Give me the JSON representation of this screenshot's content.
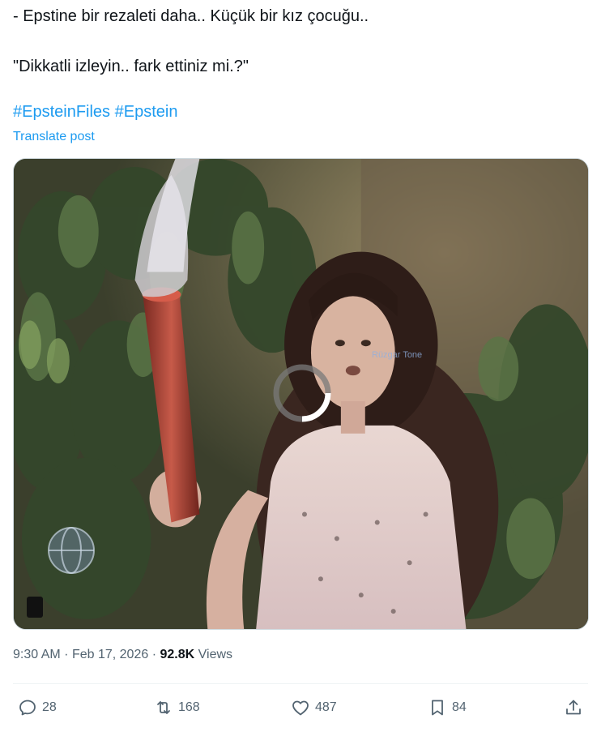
{
  "post": {
    "line1": "- Epstine bir rezaleti daha.. Küçük bir kız çocuğu..",
    "line2": "\"Dikkatli izleyin.. fark ettiniz mi.?\"",
    "hashtags": [
      "#EpsteinFiles",
      "#Epstein"
    ],
    "translate_label": "Translate post"
  },
  "media": {
    "watermark": "Rüzgar Tone"
  },
  "meta": {
    "time": "9:30 AM",
    "date": "Feb 17, 2026",
    "separator": "·",
    "views_count": "92.8K",
    "views_label": "Views"
  },
  "actions": {
    "replies": "28",
    "reposts": "168",
    "likes": "487",
    "bookmarks": "84"
  },
  "colors": {
    "link": "#1d9bf0",
    "text": "#0f1419",
    "muted": "#536471"
  }
}
